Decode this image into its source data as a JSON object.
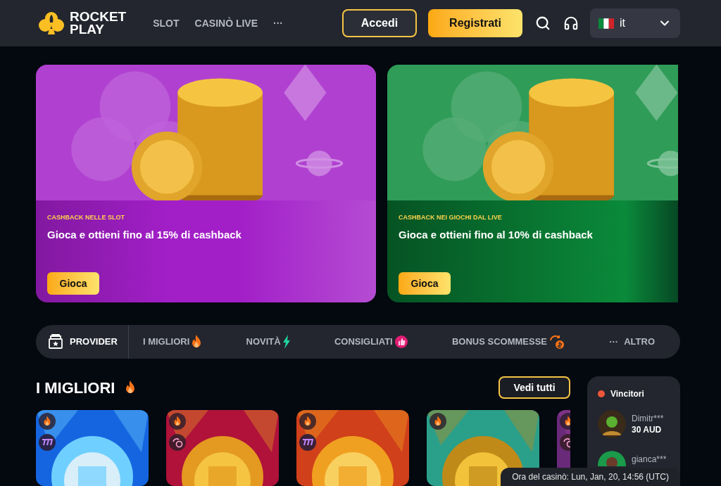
{
  "header": {
    "logo": {
      "line1": "ROCKET",
      "line2": "PLAY"
    },
    "nav": [
      "SLOT",
      "CASINÒ LIVE",
      "···"
    ],
    "login": "Accedi",
    "register": "Registrati",
    "language": "it"
  },
  "banners": [
    {
      "color": "#a21fc8",
      "eyebrow": "CASHBACK NELLE SLOT",
      "title": "Gioca e ottieni fino al 15% di cashback",
      "button": "Gioca"
    },
    {
      "color": "#0a8a3a",
      "eyebrow": "CASHBACK NEI GIOCHI DAL LIVE",
      "title": "Gioca e ottieni fino al 10% di cashback",
      "button": "Gioca"
    }
  ],
  "categories": [
    {
      "kind": "provider",
      "label": "PROVIDER",
      "selected": true
    },
    {
      "kind": "fire",
      "label": "I MIGLIORI",
      "selected": false
    },
    {
      "kind": "bolt",
      "label": "NOVITÀ",
      "selected": false
    },
    {
      "kind": "thumb",
      "label": "CONSIGLIATI",
      "selected": false
    },
    {
      "kind": "bonus",
      "label": "BONUS SCOMMESSE",
      "selected": false
    },
    {
      "kind": "more",
      "dots": "···",
      "label": "ALTRO",
      "selected": false
    }
  ],
  "section": {
    "title": "I MIGLIORI",
    "button": "Vedi tutti"
  },
  "games": [
    {
      "kind": "picture",
      "badges": [
        {
          "kind": "fire"
        },
        {
          "kind": "slot"
        }
      ]
    },
    {
      "kind": "picture",
      "badges": [
        {
          "kind": "fire"
        },
        {
          "kind": "bonus"
        }
      ]
    },
    {
      "kind": "picture",
      "badges": [
        {
          "kind": "fire"
        },
        {
          "kind": "slot"
        }
      ]
    },
    {
      "kind": "picture",
      "badges": [
        {
          "kind": "fire"
        }
      ]
    },
    {
      "kind": "picture",
      "badges": [
        {
          "kind": "fire"
        },
        {
          "kind": "bonus"
        }
      ]
    }
  ],
  "winners": {
    "title": "Vincitori",
    "entries": [
      {
        "name": "Dimitr***",
        "amount": "30 AUD"
      },
      {
        "name": "gianca***"
      }
    ]
  },
  "clock": "Ora del casinò: Lun, Jan, 20, 14:56 (UTC)"
}
